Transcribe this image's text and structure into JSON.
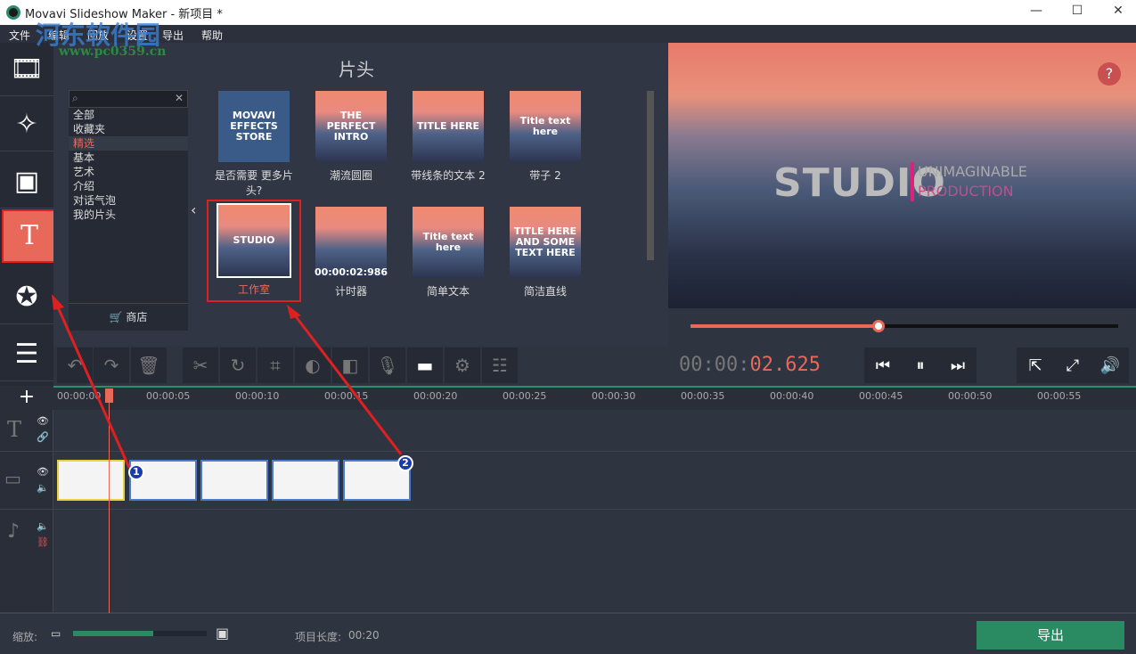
{
  "window": {
    "title": "Movavi Slideshow Maker - 新项目 *",
    "minimize": "—",
    "maximize": "☐",
    "close": "✕"
  },
  "menu": [
    "文件",
    "编辑",
    "回放",
    "设置",
    "导出",
    "帮助"
  ],
  "watermark": {
    "text": "河东软件园",
    "url": "www.pc0359.cn"
  },
  "sidebar": [
    {
      "icon": "film-import-icon"
    },
    {
      "icon": "magic-wand-icon"
    },
    {
      "icon": "transition-icon"
    },
    {
      "icon": "titles-icon",
      "active": true
    },
    {
      "icon": "stickers-icon"
    },
    {
      "icon": "menu-list-icon"
    }
  ],
  "panel": {
    "title": "片头",
    "categories": [
      "全部",
      "收藏夹",
      "精选",
      "基本",
      "艺术",
      "介绍",
      "对话气泡",
      "我的片头"
    ],
    "selected_category": "精选",
    "store_label": "商店",
    "tiles": [
      {
        "label": "是否需要 更多片头?",
        "thumb": "MOVAVI EFFECTS STORE"
      },
      {
        "label": "潮流圆圈",
        "thumb": "THE PERFECT INTRO"
      },
      {
        "label": "带线条的文本 2",
        "thumb": "TITLE HERE"
      },
      {
        "label": "带子 2",
        "thumb": "Title text here"
      },
      {
        "label": "工作室",
        "thumb": "STUDIO",
        "selected": true
      },
      {
        "label": "计时器",
        "thumb": "00:00:02:986"
      },
      {
        "label": "简单文本",
        "thumb": "Title text here"
      },
      {
        "label": "简洁直线",
        "thumb": "TITLE HERE AND SOME TEXT HERE"
      }
    ]
  },
  "preview": {
    "studio": "STUDIO",
    "line1": "UNIMAGINABLE",
    "line2": "PRODUCTION",
    "help": "?",
    "progress": 0.44,
    "time_dim": "00:00:",
    "time_active": "02.625"
  },
  "timeline": {
    "ticks": [
      "00:00:00",
      "00:00:05",
      "00:00:10",
      "00:00:15",
      "00:00:20",
      "00:00:25",
      "00:00:30",
      "00:00:35",
      "00:00:40",
      "00:00:45",
      "00:00:50",
      "00:00:55"
    ]
  },
  "markers": [
    "1",
    "2"
  ],
  "footer": {
    "zoom_label": "缩放:",
    "zoom_level": 0.6,
    "length_label": "项目长度:",
    "length_value": "00:20",
    "export": "导出"
  }
}
